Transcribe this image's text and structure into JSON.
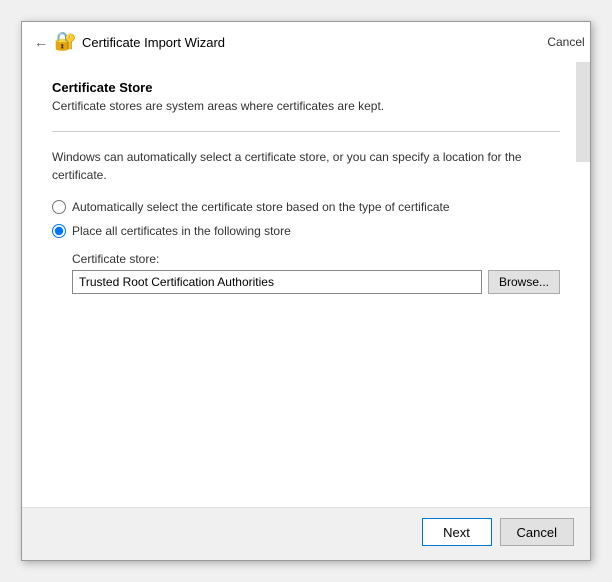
{
  "titleBar": {
    "title": "Certificate Import Wizard",
    "closeLabel": "✕",
    "backLabel": "←"
  },
  "section": {
    "title": "Certificate Store",
    "description": "Certificate stores are system areas where certificates are kept."
  },
  "introText": "Windows can automatically select a certificate store, or you can specify a location for the certificate.",
  "options": [
    {
      "id": "auto",
      "label": "Automatically select the certificate store based on the type of certificate",
      "checked": false
    },
    {
      "id": "manual",
      "label": "Place all certificates in the following store",
      "checked": true
    }
  ],
  "storeField": {
    "label": "Certificate store:",
    "value": "Trusted Root Certification Authorities",
    "browseLabel": "Browse..."
  },
  "footer": {
    "nextLabel": "Next",
    "cancelLabel": "Cancel"
  },
  "icons": {
    "wizard": "🔐",
    "back": "←",
    "close": "✕"
  }
}
